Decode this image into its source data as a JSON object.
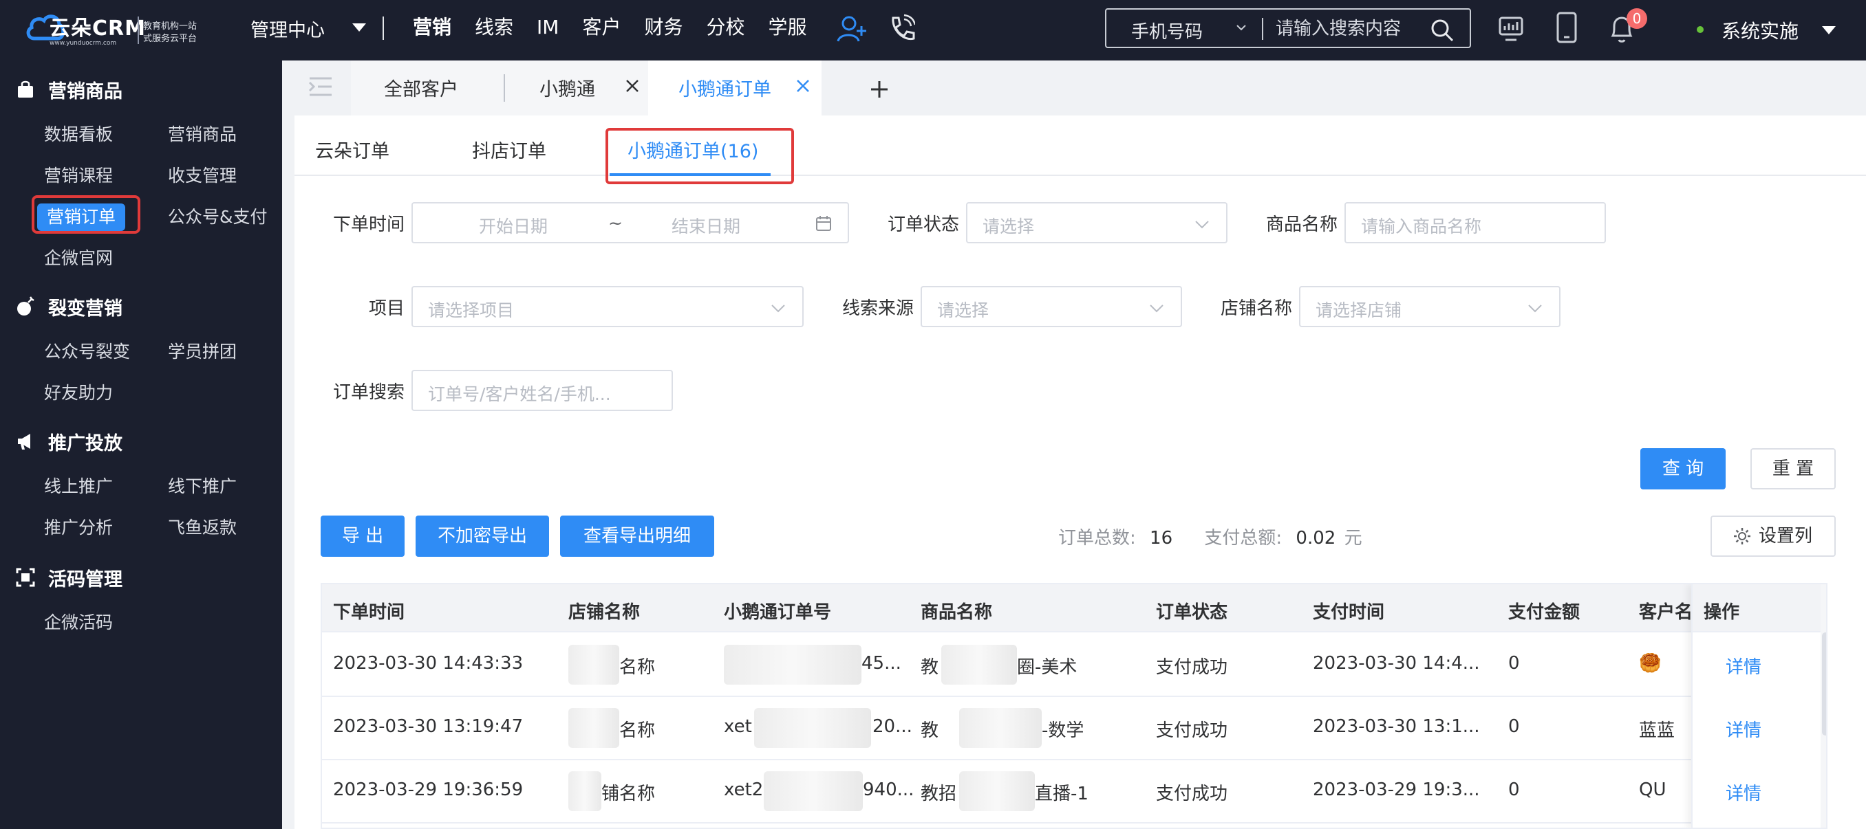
{
  "brand": {
    "name": "云朵CRM",
    "url": "www.yunduocrm.com",
    "slogan_line1": "教育机构一站",
    "slogan_line2": "式服务云平台"
  },
  "topnav": {
    "center_label": "管理中心",
    "items": [
      {
        "label": "营销",
        "active": true
      },
      {
        "label": "线索"
      },
      {
        "label": "IM"
      },
      {
        "label": "客户"
      },
      {
        "label": "财务"
      },
      {
        "label": "分校"
      },
      {
        "label": "学服"
      }
    ],
    "search": {
      "type_label": "手机号码",
      "placeholder": "请输入搜索内容"
    },
    "notification_count": "0",
    "user_name": "系统实施"
  },
  "sidebar": {
    "sections": [
      {
        "label": "营销商品",
        "icon": "bag-icon"
      },
      {
        "label": "裂变营销",
        "icon": "bomb-icon"
      },
      {
        "label": "推广投放",
        "icon": "megaphone-icon"
      },
      {
        "label": "活码管理",
        "icon": "qrcode-icon"
      }
    ],
    "items": {
      "dashboard": "数据看板",
      "products": "营销商品",
      "courses": "营销课程",
      "income": "收支管理",
      "orders": "营销订单",
      "wechat_pay": "公众号&支付",
      "site": "企微官网",
      "oa_fission": "公众号裂变",
      "group_buy": "学员拼团",
      "friend_help": "好友助力",
      "online_promo": "线上推广",
      "offline_promo": "线下推广",
      "promo_analysis": "推广分析",
      "feiyu": "飞鱼返款",
      "wecom_code": "企微活码"
    }
  },
  "page_tabs": [
    {
      "label": "全部客户"
    },
    {
      "label": "小鹅通"
    },
    {
      "label": "小鹅通订单",
      "active": true
    }
  ],
  "sub_tabs": [
    {
      "label": "云朵订单"
    },
    {
      "label": "抖店订单"
    },
    {
      "label": "小鹅通订单(16)",
      "active": true
    }
  ],
  "filters": {
    "order_time": {
      "label": "下单时间",
      "start_placeholder": "开始日期",
      "separator": "~",
      "end_placeholder": "结束日期"
    },
    "order_status": {
      "label": "订单状态",
      "placeholder": "请选择"
    },
    "product_name": {
      "label": "商品名称",
      "placeholder": "请输入商品名称"
    },
    "project": {
      "label": "项目",
      "placeholder": "请选择项目"
    },
    "lead_source": {
      "label": "线索来源",
      "placeholder": "请选择"
    },
    "shop_name": {
      "label": "店铺名称",
      "placeholder": "请选择店铺"
    },
    "order_search": {
      "label": "订单搜索",
      "placeholder": "订单号/客户姓名/手机..."
    }
  },
  "actions": {
    "query": "查 询",
    "reset": "重 置",
    "export": "导 出",
    "export_plain": "不加密导出",
    "export_detail": "查看导出明细",
    "set_columns": "设置列"
  },
  "summary": {
    "total_orders_label": "订单总数:",
    "total_orders": "16",
    "total_paid_label": "支付总额:",
    "total_paid": "0.02",
    "currency": "元"
  },
  "table": {
    "columns": [
      "下单时间",
      "店铺名称",
      "小鹅通订单号",
      "商品名称",
      "订单状态",
      "支付时间",
      "支付金额",
      "客户名",
      "操作"
    ],
    "rows": [
      {
        "order_time": "2023-03-30 14:43:33",
        "shop": "名称",
        "order_no": "45...",
        "product_prefix": "教",
        "product_suffix": "圈-美术",
        "status": "支付成功",
        "pay_time": "2023-03-30 14:4...",
        "amount": "0",
        "customer": "🥮",
        "action": "详情"
      },
      {
        "order_time": "2023-03-30 13:19:47",
        "shop": "名称",
        "order_no_prefix": "xet",
        "order_no": "20...",
        "product_prefix": "教‌",
        "product_suffix": "-数学",
        "status": "支付成功",
        "pay_time": "2023-03-30 13:1...",
        "amount": "0",
        "customer": "蓝蓝",
        "action": "详情"
      },
      {
        "order_time": "2023-03-29 19:36:59",
        "shop": "铺名称",
        "order_no_prefix": "xet2",
        "order_no": "940...",
        "product_prefix": "教招",
        "product_suffix": "直播-1",
        "status": "支付成功",
        "pay_time": "2023-03-29 19:3...",
        "amount": "0",
        "customer": "QU",
        "action": "详情"
      }
    ]
  },
  "colors": {
    "primary": "#2f8cf5",
    "dark_bg": "#1b1f2e",
    "highlight_red": "#e03a3a",
    "badge_red": "#f56c6c"
  }
}
